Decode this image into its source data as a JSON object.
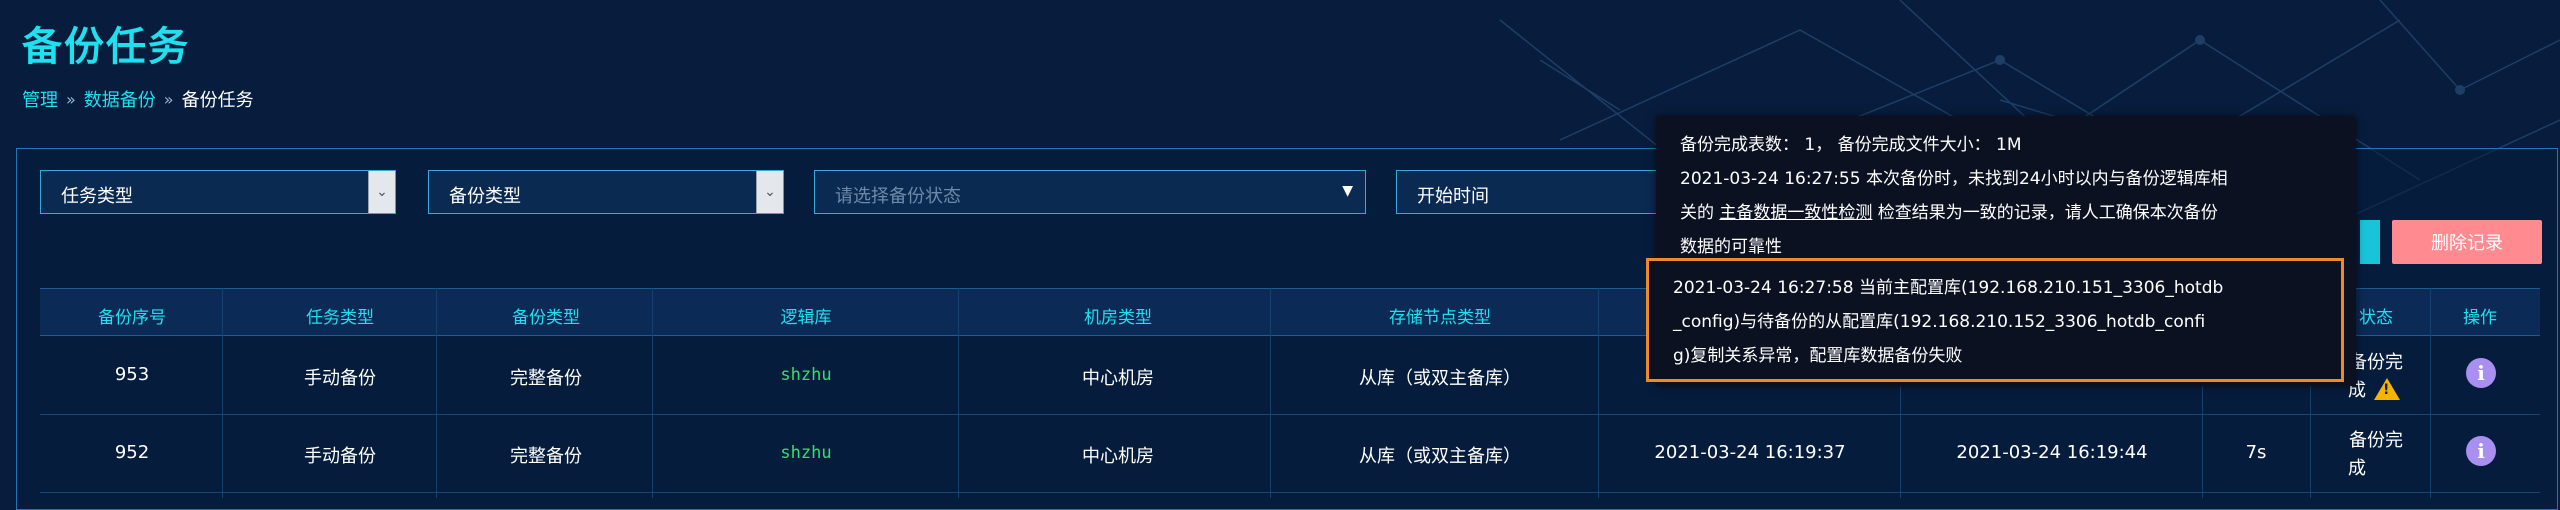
{
  "page": {
    "title": "备份任务"
  },
  "breadcrumb": {
    "items": [
      "管理",
      "数据备份",
      "备份任务"
    ],
    "separator": "»"
  },
  "filters": {
    "task_type": "任务类型",
    "backup_type": "备份类型",
    "status_placeholder": "请选择备份状态",
    "start_time": "开始时间"
  },
  "actions": {
    "delete_label": "删除记录"
  },
  "table": {
    "headers": {
      "seq": "备份序号",
      "task_type": "任务类型",
      "backup_type": "备份类型",
      "logic_db": "逻辑库",
      "room_type": "机房类型",
      "node_type": "存储节点类型",
      "status": "状态",
      "op": "操作"
    },
    "rows": [
      {
        "seq": "953",
        "task_type": "手动备份",
        "backup_type": "完整备份",
        "logic_db": "shzhu",
        "room_type": "中心机房",
        "node_type": "从库（或双主备库）",
        "start": "",
        "end": "",
        "dur": "",
        "status_l1": "备份完",
        "status_l2": "成"
      },
      {
        "seq": "952",
        "task_type": "手动备份",
        "backup_type": "完整备份",
        "logic_db": "shzhu",
        "room_type": "中心机房",
        "node_type": "从库（或双主备库）",
        "start": "2021-03-24 16:19:37",
        "end": "2021-03-24 16:19:44",
        "dur": "7s",
        "status_l1": "备份完",
        "status_l2": "成"
      }
    ]
  },
  "tooltip": {
    "line1": "备份完成表数： 1，  备份完成文件大小：  1M",
    "line2": "2021-03-24 16:27:55 本次备份时，未找到24小时以内与备份逻辑库相",
    "line3_pre": "关的 ",
    "line3_link": "主备数据一致性检测",
    "line3_post": " 检查结果为一致的记录，请人工确保本次备份",
    "line4": "数据的可靠性",
    "error_line1": "2021-03-24 16:27:58 当前主配置库(192.168.210.151_3306_hotdb",
    "error_line2": "_config)与待备份的从配置库(192.168.210.152_3306_hotdb_confi",
    "error_line3": "g)复制关系异常，配置库数据备份失败"
  },
  "colors": {
    "accent": "#1ee0ee",
    "background": "#081d3d",
    "highlight": "#f08a24",
    "danger": "#ff8a8f",
    "logic_db": "#2fe070"
  }
}
